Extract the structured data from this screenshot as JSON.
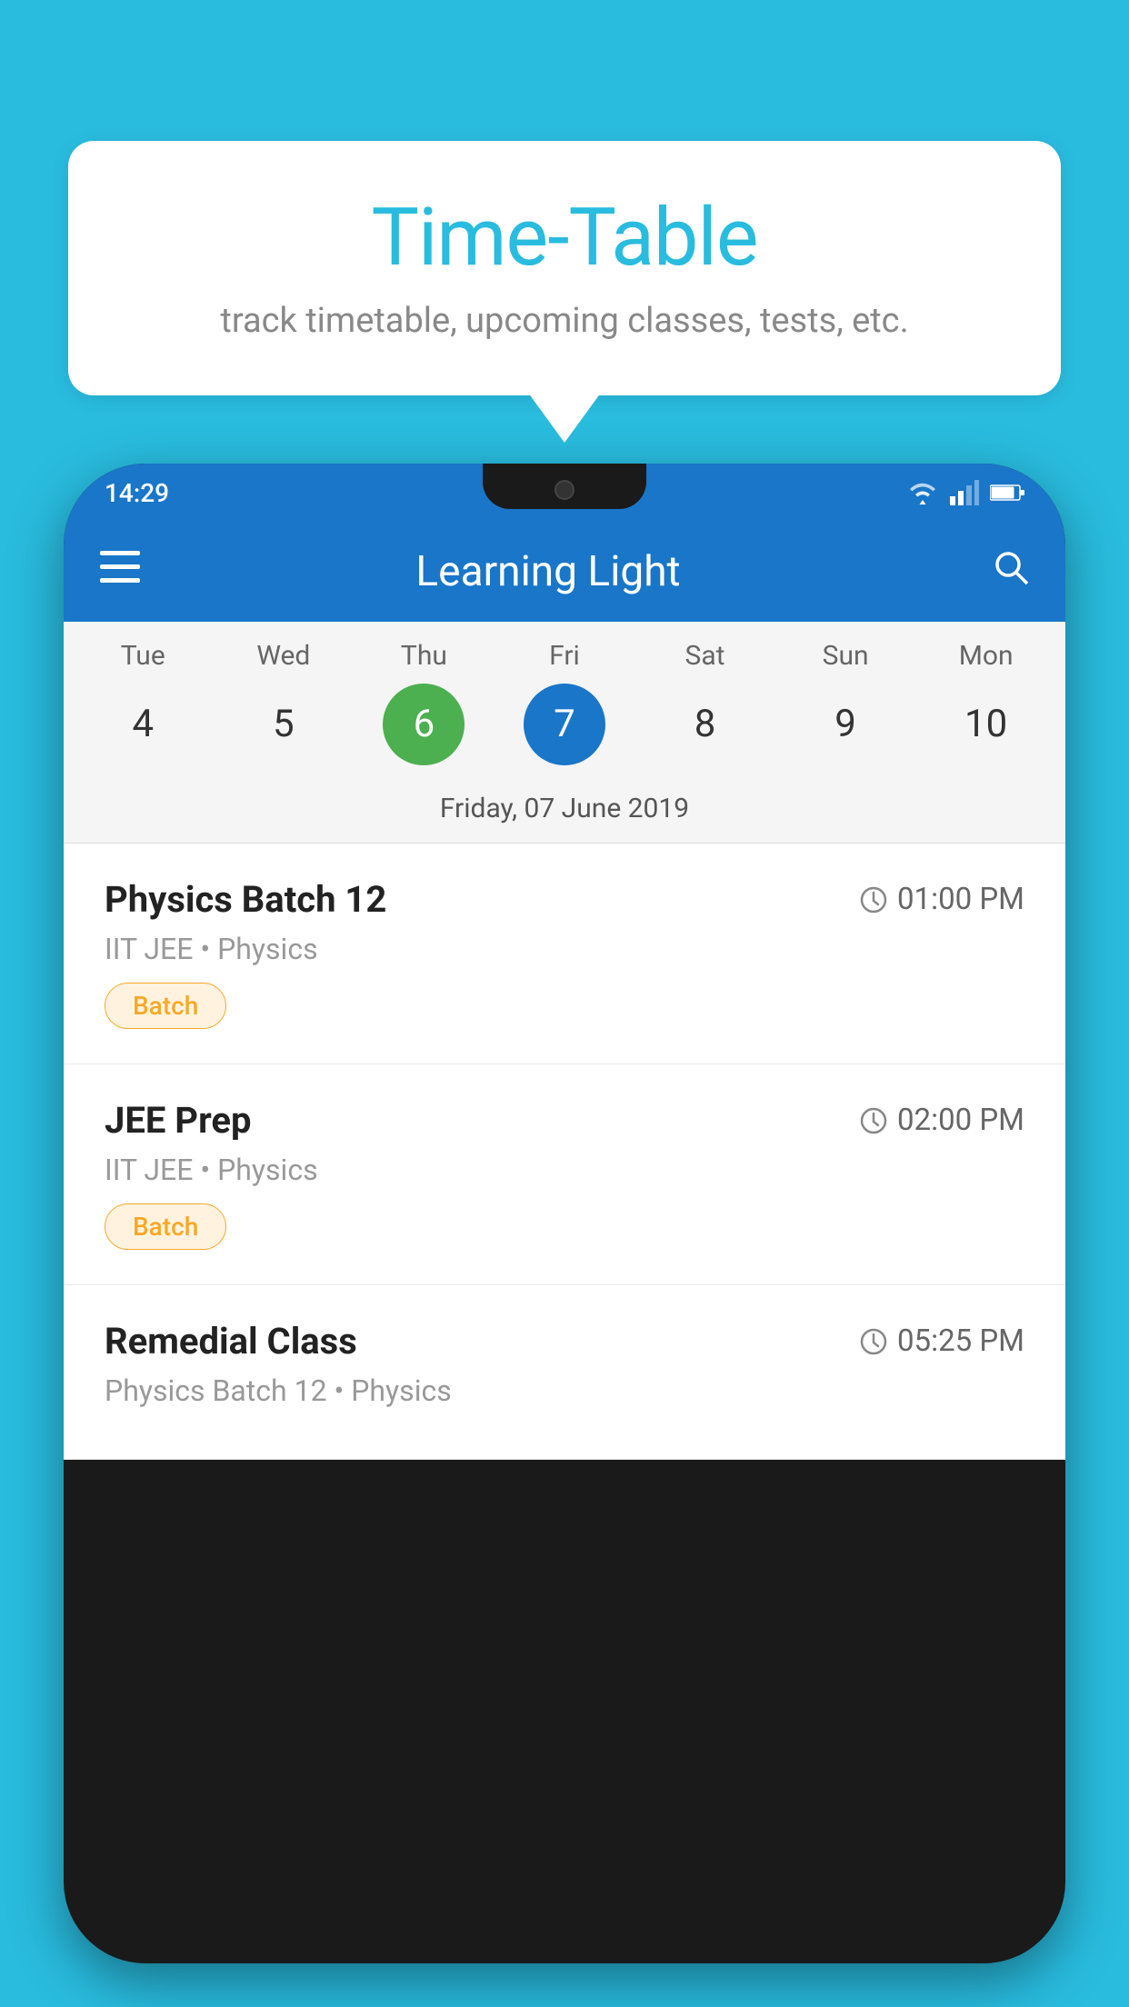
{
  "background_color": "#29BCDF",
  "bubble": {
    "title": "Time-Table",
    "subtitle": "track timetable, upcoming classes, tests, etc."
  },
  "phone": {
    "status_bar": {
      "time": "14:29"
    },
    "app_bar": {
      "title": "Learning Light"
    },
    "calendar": {
      "days": [
        {
          "abbr": "Tue",
          "num": "4"
        },
        {
          "abbr": "Wed",
          "num": "5"
        },
        {
          "abbr": "Thu",
          "num": "6",
          "state": "today"
        },
        {
          "abbr": "Fri",
          "num": "7",
          "state": "selected"
        },
        {
          "abbr": "Sat",
          "num": "8"
        },
        {
          "abbr": "Sun",
          "num": "9"
        },
        {
          "abbr": "Mon",
          "num": "10"
        }
      ],
      "selected_date_label": "Friday, 07 June 2019"
    },
    "schedule": [
      {
        "title": "Physics Batch 12",
        "time": "01:00 PM",
        "meta": "IIT JEE • Physics",
        "tag": "Batch"
      },
      {
        "title": "JEE Prep",
        "time": "02:00 PM",
        "meta": "IIT JEE • Physics",
        "tag": "Batch"
      },
      {
        "title": "Remedial Class",
        "time": "05:25 PM",
        "meta": "Physics Batch 12 • Physics",
        "tag": ""
      }
    ]
  },
  "icons": {
    "hamburger": "☰",
    "search": "🔍",
    "clock": "🕐"
  }
}
